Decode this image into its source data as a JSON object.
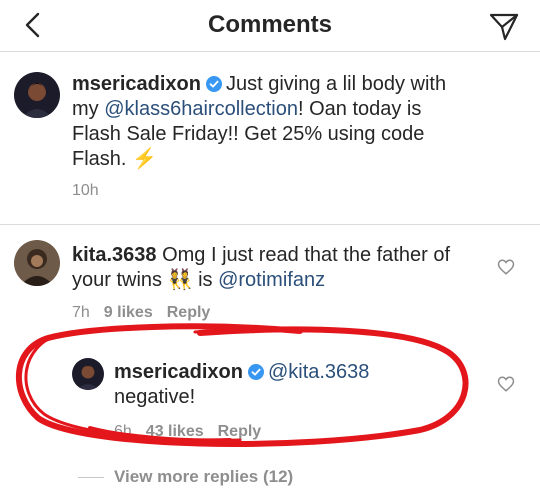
{
  "header": {
    "title": "Comments",
    "back_icon": "chevron-left-icon",
    "share_icon": "paper-plane-icon"
  },
  "caption": {
    "username": "msericadixon",
    "text_before_mention": "Just giving a lil body with my",
    "mention": "@klass6haircollection",
    "text_after_mention": "! Oan today is Flash Sale Friday!! Get 25% using code Flash.",
    "emoji": "⚡",
    "time": "10h"
  },
  "comment": {
    "username": "kita.3638",
    "text_before_emoji": "Omg I just read that the father of your twins",
    "emoji": "👯",
    "text_after_emoji": "is",
    "mention": "@rotimifanz",
    "time": "7h",
    "likes": "9 likes",
    "reply": "Reply"
  },
  "reply": {
    "username": "msericadixon",
    "mention": "@kita.3638",
    "text": "negative!",
    "time": "6h",
    "likes": "43 likes",
    "reply": "Reply"
  },
  "view_more": "View more replies (12)",
  "colors": {
    "text": "#262626",
    "secondary": "#8e8e8e",
    "link": "#2b4f7a",
    "verified": "#3897f0",
    "annotation": "#e3161c"
  }
}
